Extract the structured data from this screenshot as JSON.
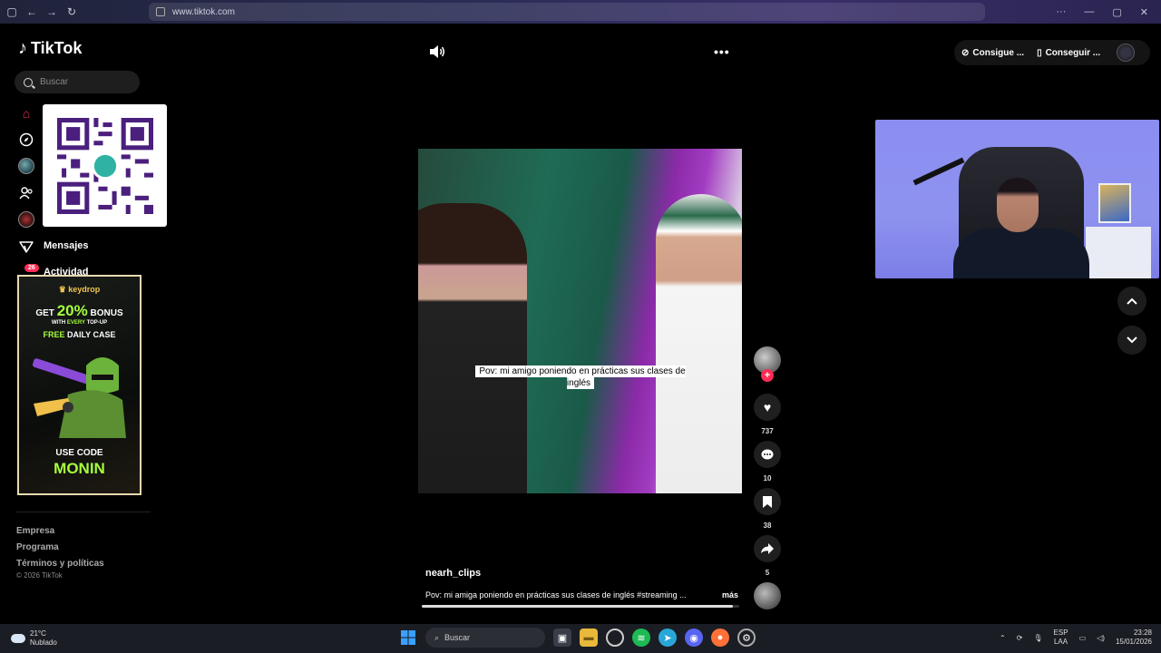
{
  "browser": {
    "url": "www.tiktok.com"
  },
  "sidebar": {
    "logo": "TikTok",
    "search_placeholder": "Buscar",
    "messages_label": "Mensajes",
    "activity_label": "Actividad",
    "activity_badge": "26",
    "ad": {
      "brand": "keydrop",
      "get": "GET",
      "percent": "20%",
      "bonus": "BONUS",
      "with_every_1": "WITH",
      "every": "EVERY",
      "topup": "TOP-UP",
      "free": "FREE",
      "daily_case": "DAILY CASE",
      "use_code": "USE CODE",
      "code": "MONIN"
    },
    "footer": {
      "links": [
        "Empresa",
        "Programa",
        "Términos y políticas"
      ],
      "copyright": "© 2026 TikTok"
    }
  },
  "topbar": {
    "get_coins_label": "Consigue ...",
    "get_app_label": "Conseguir ..."
  },
  "video": {
    "caption_overlay": "Pov: mi amigo poniendo en prácticas sus clases de inglés",
    "author": "nearh_clips",
    "description": "Pov: mi amiga poniendo en prácticas sus clases de inglés #streaming ...",
    "more_label": "más",
    "progress": 0.98
  },
  "actions": {
    "likes": "737",
    "comments": "10",
    "saves": "38",
    "shares": "5"
  },
  "taskbar": {
    "temperature": "21°C",
    "weather": "Nublado",
    "search_label": "Buscar",
    "lang_1": "ESP",
    "lang_2": "LAA",
    "time": "23:28",
    "date": "15/01/2026"
  },
  "colors": {
    "accent": "#fe2c55",
    "ad_highlight": "#a6ff3c"
  }
}
